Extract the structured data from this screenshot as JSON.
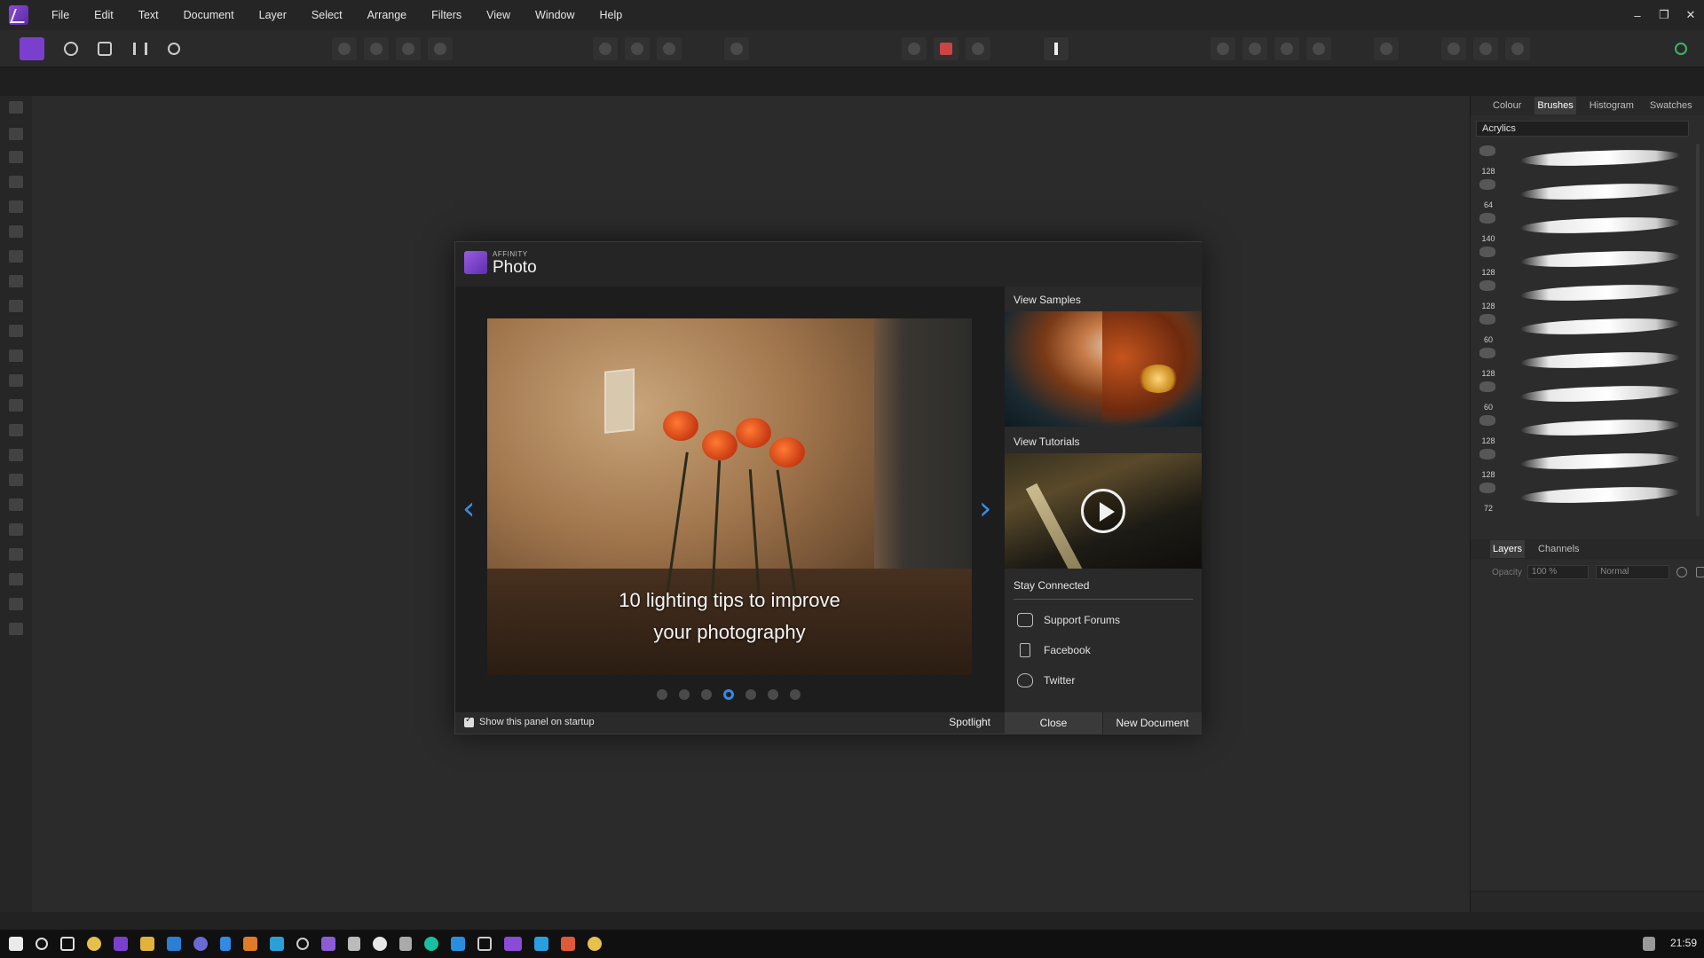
{
  "menu": {
    "items": [
      "File",
      "Edit",
      "Text",
      "Document",
      "Layer",
      "Select",
      "Arrange",
      "Filters",
      "View",
      "Window",
      "Help"
    ]
  },
  "window_controls": {
    "minimize": "–",
    "restore": "❐",
    "close": "✕"
  },
  "colors": {
    "accent": "#2f8be6",
    "brand": "#7b3fd0",
    "panel_bg": "#2c2c2c",
    "workspace_bg": "#2b2b2b"
  },
  "right_panel": {
    "tabs": [
      "Colour",
      "Brushes",
      "Histogram",
      "Swatches"
    ],
    "active_tab": "Brushes",
    "brush_category": "Acrylics",
    "brush_sizes": [
      "128",
      "64",
      "140",
      "128",
      "128",
      "60",
      "128",
      "60",
      "128",
      "128",
      "72"
    ],
    "layers_tabs": [
      "Layers",
      "Channels"
    ],
    "opacity_label": "Opacity",
    "opacity_value": "100 %",
    "blend_mode": "Normal"
  },
  "welcome": {
    "brand_small": "AFFINITY",
    "brand": "Photo",
    "spotlight_caption_line1": "10 lighting tips to improve",
    "spotlight_caption_line2": "your photography",
    "dots_count": 7,
    "active_dot": 3,
    "view_samples": "View Samples",
    "view_tutorials": "View Tutorials",
    "stay_connected": "Stay Connected",
    "support_forums": "Support Forums",
    "facebook": "Facebook",
    "twitter": "Twitter",
    "show_on_startup": "Show this panel on startup",
    "spotlight": "Spotlight",
    "close": "Close",
    "new_document": "New Document"
  },
  "taskbar": {
    "clock": "21:59"
  }
}
